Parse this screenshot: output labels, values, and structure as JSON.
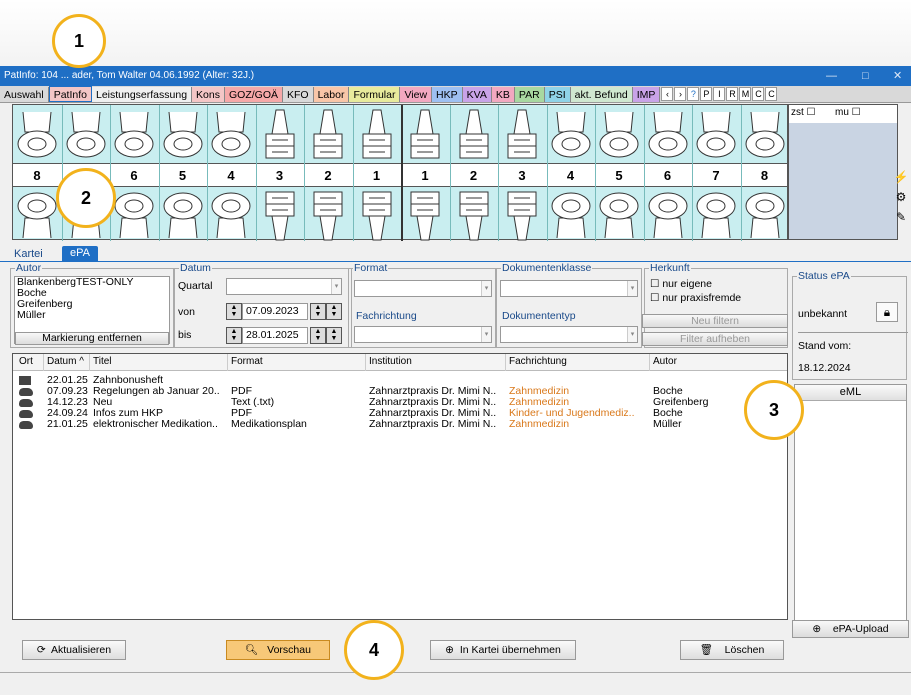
{
  "window": {
    "title": "PatInfo: 104 ... ader, Tom Walter  04.06.1992 (Alter: 32J.)"
  },
  "tabs": [
    "Auswahl",
    "PatInfo",
    "Leistungserfassung",
    "Kons",
    "GOZ/GOÄ",
    "KFO",
    "Labor",
    "Formular",
    "View",
    "HKP",
    "KVA",
    "KB",
    "PAR",
    "PSI",
    "akt. Befund",
    "IMP"
  ],
  "tab_colors": [
    "#d9d9d9",
    "#f4c6c6",
    "#f0f0f0",
    "#f4c6c6",
    "#f6a8a8",
    "#d9d9d9",
    "#f9c6a8",
    "#e8eb9c",
    "#f2a8c0",
    "#9ec0f2",
    "#c9a3e8",
    "#f2a8c0",
    "#a8d8a0",
    "#8fd3e8",
    "#d0e8d0",
    "#c9a3e8"
  ],
  "toolbar_letters": [
    "P",
    "I",
    "R",
    "M",
    "C",
    "C"
  ],
  "tooth_numbers": [
    "8",
    "7",
    "6",
    "5",
    "4",
    "3",
    "2",
    "1",
    "1",
    "2",
    "3",
    "4",
    "5",
    "6",
    "7",
    "8"
  ],
  "rightpanel": {
    "zst": "zst",
    "mu": "mu"
  },
  "subtabs": [
    "Kartei",
    "ePA"
  ],
  "filters": {
    "autor_label": "Autor",
    "autor_items": [
      "BlankenbergTEST-ONLY",
      "Boche",
      "Greifenberg",
      "Müller"
    ],
    "markierung_button": "Markierung entfernen",
    "datum_label": "Datum",
    "quartal_label": "Quartal",
    "von_label": "von",
    "von_value": "07.09.2023",
    "bis_label": "bis",
    "bis_value": "28.01.2025",
    "format_label": "Format",
    "fachrichtung_label": "Fachrichtung",
    "dokumentenklasse_label": "Dokumentenklasse",
    "dokumententyp_label": "Dokumententyp",
    "herkunft_label": "Herkunft",
    "nur_eigene": "nur eigene",
    "nur_praxisfremde": "nur praxisfremde",
    "neu_filtern": "Neu filtern",
    "filter_aufheben": "Filter aufheben"
  },
  "status": {
    "title": "Status ePA",
    "value": "unbekannt",
    "stand_label": "Stand vom:",
    "stand_value": "18.12.2024",
    "eml_label": "eML",
    "upload_label": "ePA-Upload"
  },
  "list": {
    "headers": [
      "Ort",
      "Datum ^",
      "Titel",
      "Format",
      "Institution",
      "Fachrichtung",
      "Autor"
    ],
    "rows": [
      {
        "icon": "folder",
        "datum": "22.01.25",
        "titel": "Zahnbonusheft",
        "format": "",
        "institution": "",
        "fachrichtung": "",
        "autor": ""
      },
      {
        "icon": "cloud",
        "datum": "07.09.23",
        "titel": "Regelungen ab Januar 20..",
        "format": "PDF",
        "institution": "Zahnarztpraxis Dr. Mimi N..",
        "fachrichtung": "Zahnmedizin",
        "autor": "Boche"
      },
      {
        "icon": "cloud",
        "datum": "14.12.23",
        "titel": "Neu",
        "format": "Text (.txt)",
        "institution": "Zahnarztpraxis Dr. Mimi N..",
        "fachrichtung": "Zahnmedizin",
        "autor": "Greifenberg"
      },
      {
        "icon": "cloud",
        "datum": "24.09.24",
        "titel": "Infos zum HKP",
        "format": "PDF",
        "institution": "Zahnarztpraxis Dr. Mimi N..",
        "fachrichtung": "Kinder- und Jugendmediz..",
        "autor": "Boche"
      },
      {
        "icon": "cloud",
        "datum": "21.01.25",
        "titel": "elektronischer Medikation..",
        "format": "Medikationsplan",
        "institution": "Zahnarztpraxis Dr. Mimi N..",
        "fachrichtung": "Zahnmedizin",
        "autor": "Müller"
      }
    ]
  },
  "buttons": {
    "aktualisieren": "Aktualisieren",
    "vorschau": "Vorschau",
    "kartei": "In Kartei übernehmen",
    "loeschen": "Löschen"
  },
  "callouts": [
    "1",
    "2",
    "3",
    "4"
  ]
}
